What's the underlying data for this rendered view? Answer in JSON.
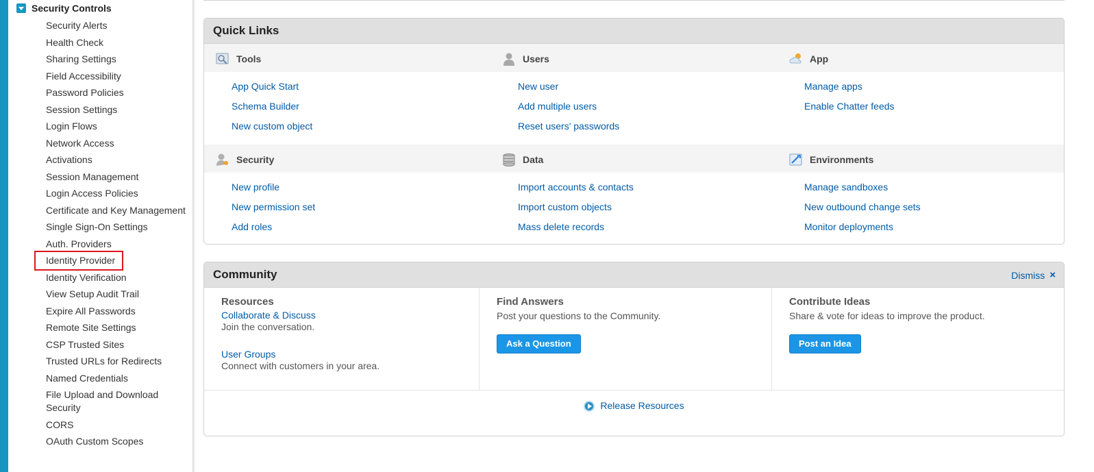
{
  "sidebar": {
    "section_title": "Security Controls",
    "items": [
      "Security Alerts",
      "Health Check",
      "Sharing Settings",
      "Field Accessibility",
      "Password Policies",
      "Session Settings",
      "Login Flows",
      "Network Access",
      "Activations",
      "Session Management",
      "Login Access Policies",
      "Certificate and Key Management",
      "Single Sign-On Settings",
      "Auth. Providers",
      "Identity Provider",
      "Identity Verification",
      "View Setup Audit Trail",
      "Expire All Passwords",
      "Remote Site Settings",
      "CSP Trusted Sites",
      "Trusted URLs for Redirects",
      "Named Credentials",
      "File Upload and Download Security",
      "CORS",
      "OAuth Custom Scopes"
    ],
    "highlighted_item": "Identity Provider"
  },
  "quick_links": {
    "title": "Quick Links",
    "groups": [
      {
        "title": "Tools",
        "icon": "tools-icon",
        "links": [
          "App Quick Start",
          "Schema Builder",
          "New custom object"
        ]
      },
      {
        "title": "Users",
        "icon": "user-icon",
        "links": [
          "New user",
          "Add multiple users",
          "Reset users' passwords"
        ]
      },
      {
        "title": "App",
        "icon": "app-cloud-icon",
        "links": [
          "Manage apps",
          "Enable Chatter feeds"
        ]
      },
      {
        "title": "Security",
        "icon": "security-user-key-icon",
        "links": [
          "New profile",
          "New permission set",
          "Add roles"
        ]
      },
      {
        "title": "Data",
        "icon": "database-icon",
        "links": [
          "Import accounts & contacts",
          "Import custom objects",
          "Mass delete records"
        ]
      },
      {
        "title": "Environments",
        "icon": "environments-icon",
        "links": [
          "Manage sandboxes",
          "New outbound change sets",
          "Monitor deployments"
        ]
      }
    ]
  },
  "community": {
    "title": "Community",
    "dismiss_label": "Dismiss",
    "dismiss_icon": "×",
    "resources": {
      "title": "Resources",
      "link1": "Collaborate & Discuss",
      "desc1": "Join the conversation.",
      "link2": "User Groups",
      "desc2": "Connect with customers in your area."
    },
    "answers": {
      "title": "Find Answers",
      "desc": "Post your questions to the Community.",
      "button": "Ask a Question"
    },
    "ideas": {
      "title": "Contribute Ideas",
      "desc": "Share & vote for ideas to improve the product.",
      "button": "Post an Idea"
    },
    "release_link": "Release Resources"
  },
  "colors": {
    "accent": "#1797c0",
    "link": "#015ba7",
    "button": "#1b96e6",
    "highlight": "#d9171c"
  }
}
